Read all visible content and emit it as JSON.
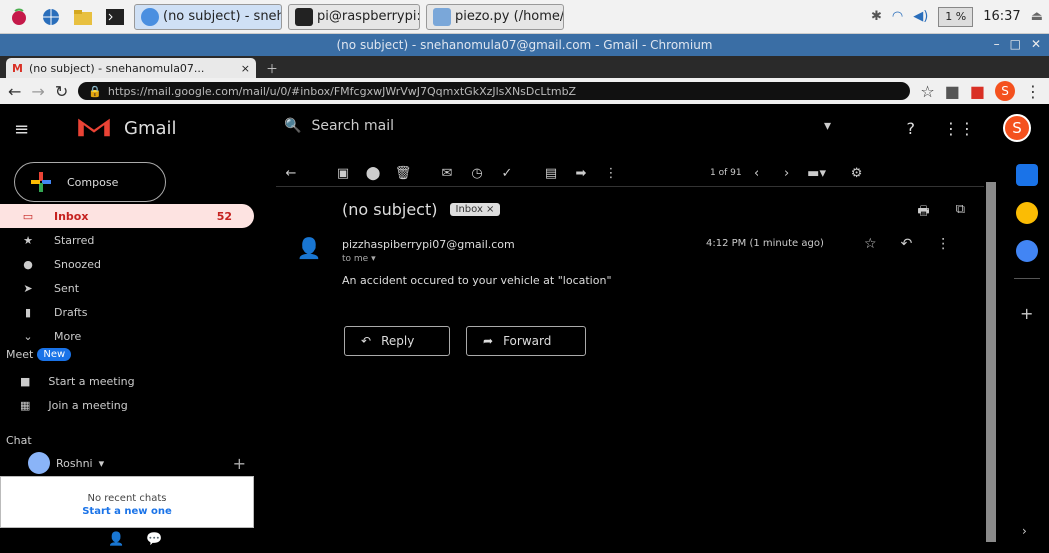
{
  "taskbar": {
    "tasks": [
      {
        "label": "(no subject) - snehan..."
      },
      {
        "label": "pi@raspberrypi: ~/ac..."
      },
      {
        "label": "piezo.py (/home/pi/a..."
      }
    ],
    "cpu": "1 %",
    "time": "16:37"
  },
  "window": {
    "title": "(no subject) - snehanomula07@gmail.com - Gmail - Chromium"
  },
  "browser": {
    "tab_title": "(no subject) - snehanomula07...",
    "url": "https://mail.google.com/mail/u/0/#inbox/FMfcgxwJWrVwJ7QqmxtGkXzJlsXNsDcLtmbZ"
  },
  "gmail": {
    "brand": "Gmail",
    "search_placeholder": "Search mail",
    "user_initial": "S",
    "compose_label": "Compose",
    "nav": [
      {
        "label": "Inbox",
        "count": "52"
      },
      {
        "label": "Starred",
        "count": ""
      },
      {
        "label": "Snoozed",
        "count": ""
      },
      {
        "label": "Sent",
        "count": ""
      },
      {
        "label": "Drafts",
        "count": ""
      },
      {
        "label": "More",
        "count": ""
      }
    ],
    "meet": {
      "label": "Meet",
      "badge": "New",
      "start": "Start a meeting",
      "join": "Join a meeting"
    },
    "chat": {
      "label": "Chat",
      "user": "Roshni",
      "empty": "No recent chats",
      "start_link": "Start a new one"
    },
    "toolbar": {
      "pager": "1 of 91"
    },
    "message": {
      "subject": "(no subject)",
      "label": "Inbox",
      "sender": "pizzhaspiberrypi07@gmail.com",
      "to": "to me",
      "time": "4:12 PM (1 minute ago)",
      "body": "An accident occured to your vehicle at \"location\""
    },
    "reply_label": "Reply",
    "forward_label": "Forward"
  },
  "colors": {
    "accent_red": "#c5221f",
    "avatar_orange": "#f4511e",
    "badge_blue": "#1a73e8"
  }
}
